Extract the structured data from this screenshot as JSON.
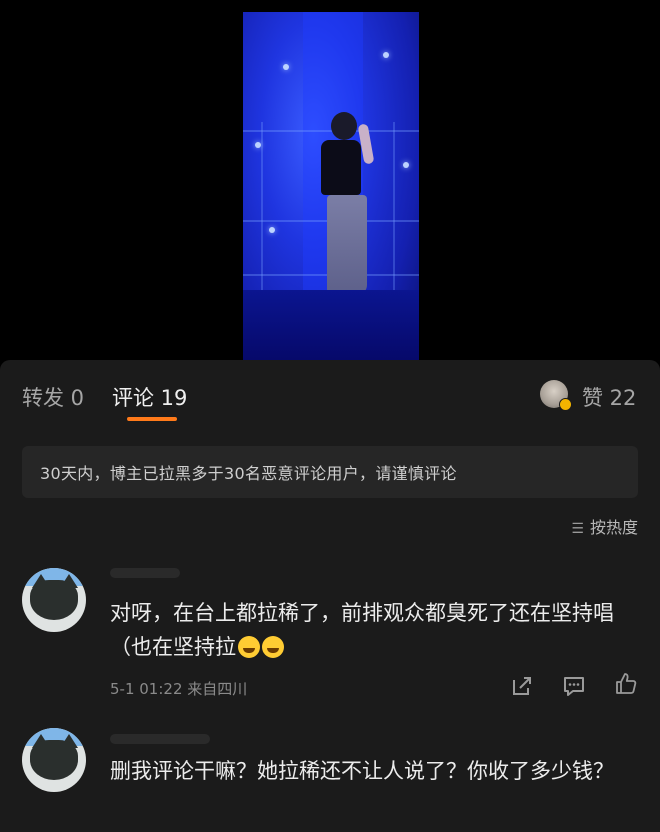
{
  "tabs": {
    "repost": "转发 0",
    "comments": "评论 19",
    "likes": "赞 22"
  },
  "notice": "30天内，博主已拉黑多于30名恶意评论用户，请谨慎评论",
  "sort": {
    "label": "按热度",
    "icon": "sort-icon"
  },
  "comments": [
    {
      "text": "对呀，在台上都拉稀了，前排观众都臭死了还在坚持唱（也在坚持拉",
      "emojis": [
        "laugh-cry-emoji",
        "laugh-cry-emoji"
      ],
      "meta": "5-1 01:22 来自四川",
      "actions": [
        "share-icon",
        "reply-icon",
        "like-icon"
      ]
    },
    {
      "text": "删我评论干嘛？她拉稀还不让人说了？你收了多少钱？"
    }
  ],
  "colors": {
    "accent": "#ff7a1a",
    "panel_bg": "#1b1b1b",
    "stage_blue": "#1f35e0"
  }
}
